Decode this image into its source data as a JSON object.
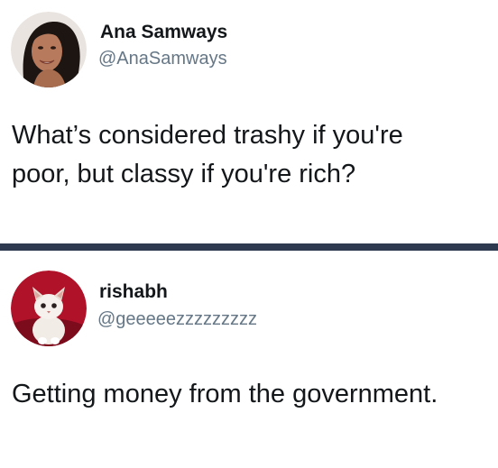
{
  "tweets": [
    {
      "author_name": "Ana Samways",
      "author_handle": "@AnaSamways",
      "text_lines": [
        "What’s considered trashy if you're",
        "poor, but classy if you're rich?"
      ]
    },
    {
      "author_name": "rishabh",
      "author_handle": "@geeeeezzzzzzzzz",
      "text_lines": [
        "Getting money from the government."
      ]
    }
  ],
  "colors": {
    "divider": "#2d3a4f",
    "handle": "#657786",
    "text": "#14171a"
  }
}
